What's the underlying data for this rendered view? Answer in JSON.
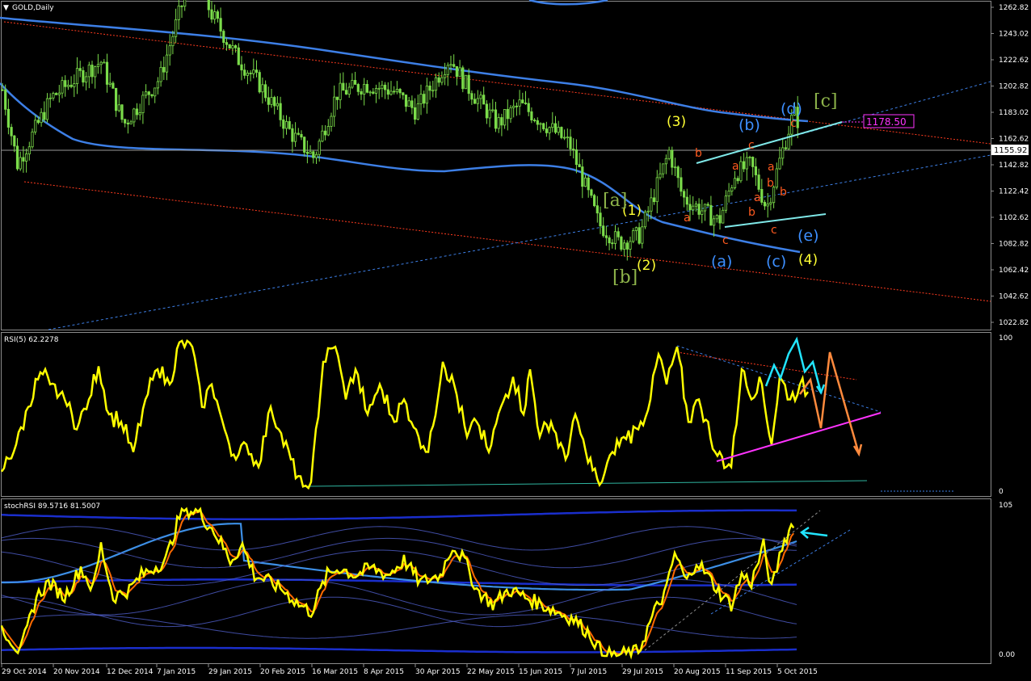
{
  "window": {
    "title": "GOLD,Daily",
    "rsi_title": "RSI(5) 62.2278",
    "stoch_title": "stochRSI 89.5716 81.5007"
  },
  "colors": {
    "background": "#000000",
    "candle": "#7bdc4a",
    "ma_blue": "#3d7fe6",
    "rsi": "#ffff00",
    "stoch_fast": "#ffff00",
    "stoch_slow": "#ff6a00",
    "channel_red": "#ff3b1f",
    "channel_blue": "#3d7fe6",
    "wedge": "#7fe8e8",
    "wave_yellow": "#ffff33",
    "wave_blue": "#3d8fff",
    "wave_orange": "#ff5a1f",
    "wave_green": "#8db34a",
    "price_box": "#ff33ff",
    "rsi_trend": "#ff33ff",
    "cyan_arrows": "#22e5ff",
    "orange_arrows": "#ff8a3d"
  },
  "price_axis": [
    "1262.82",
    "1243.02",
    "1222.62",
    "1202.82",
    "1183.02",
    "1162.62",
    "1142.82",
    "1122.42",
    "1102.62",
    "1082.82",
    "1062.42",
    "1042.62",
    "1022.82"
  ],
  "current_price": "1155.92",
  "target_price": "1178.50",
  "rsi_axis": [
    "100",
    "0"
  ],
  "stoch_axis": [
    "105",
    "0.00"
  ],
  "date_axis": [
    "29 Oct 2014",
    "20 Nov 2014",
    "12 Dec 2014",
    "7 Jan 2015",
    "29 Jan 2015",
    "20 Feb 2015",
    "16 Mar 2015",
    "8 Apr 2015",
    "30 Apr 2015",
    "22 May 2015",
    "15 Jun 2015",
    "7 Jul 2015",
    "29 Jul 2015",
    "20 Aug 2015",
    "11 Sep 2015",
    "5 Oct 2015"
  ],
  "wave_labels": {
    "yellow": [
      "(1)",
      "(2)",
      "(3)",
      "(4)"
    ],
    "green": [
      "[a]",
      "[b]",
      "[c]"
    ],
    "blue": [
      "(a)",
      "(b)",
      "(c)",
      "(d)",
      "(e)"
    ],
    "orange": [
      "a",
      "b",
      "c",
      "a",
      "b",
      "c",
      "a",
      "b",
      "c",
      "a",
      "b",
      "c",
      "c"
    ]
  },
  "chart_data": {
    "type": "line",
    "symbol": "GOLD",
    "timeframe": "Daily",
    "price_ylim": [
      1022.82,
      1270
    ],
    "close_series_approx": [
      [
        "29 Oct 2014",
        1204
      ],
      [
        "5 Nov 2014",
        1145
      ],
      [
        "20 Nov 2014",
        1195
      ],
      [
        "1 Dec 2014",
        1210
      ],
      [
        "12 Dec 2014",
        1222
      ],
      [
        "22 Dec 2014",
        1175
      ],
      [
        "7 Jan 2015",
        1210
      ],
      [
        "22 Jan 2015",
        1295
      ],
      [
        "29 Jan 2015",
        1260
      ],
      [
        "10 Feb 2015",
        1225
      ],
      [
        "20 Feb 2015",
        1205
      ],
      [
        "6 Mar 2015",
        1168
      ],
      [
        "16 Mar 2015",
        1150
      ],
      [
        "26 Mar 2015",
        1198
      ],
      [
        "8 Apr 2015",
        1205
      ],
      [
        "20 Apr 2015",
        1200
      ],
      [
        "30 Apr 2015",
        1185
      ],
      [
        "15 May 2015",
        1225
      ],
      [
        "22 May 2015",
        1205
      ],
      [
        "5 Jun 2015",
        1175
      ],
      [
        "15 Jun 2015",
        1190
      ],
      [
        "30 Jun 2015",
        1170
      ],
      [
        "7 Jul 2015",
        1160
      ],
      [
        "20 Jul 2015",
        1100
      ],
      [
        "29 Jul 2015",
        1086
      ],
      [
        "7 Aug 2015",
        1092
      ],
      [
        "20 Aug 2015",
        1155
      ],
      [
        "26 Aug 2015",
        1120
      ],
      [
        "11 Sep 2015",
        1102
      ],
      [
        "18 Sep 2015",
        1138
      ],
      [
        "25 Sep 2015",
        1145
      ],
      [
        "2 Oct 2015",
        1112
      ],
      [
        "9 Oct 2015",
        1155
      ],
      [
        "14 Oct 2015",
        1184
      ],
      [
        "16 Oct 2015",
        1177
      ]
    ],
    "rsi_ylim": [
      0,
      100
    ],
    "stoch_ylim": [
      0,
      105
    ]
  }
}
